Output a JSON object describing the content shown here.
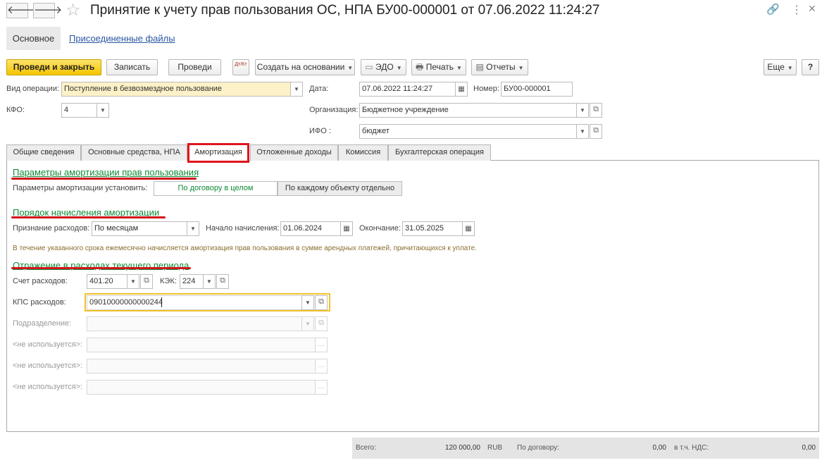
{
  "window": {
    "title": "Принятие к учету прав пользования ОС, НПА БУ00-000001 от 07.06.2022 11:24:27",
    "back_glyph": "🡐",
    "forward_glyph": "🡒",
    "star_glyph": "☆",
    "link_glyph": "🔗",
    "more_glyph": "⋮",
    "close_glyph": "✕"
  },
  "top_nav": {
    "main": "Основное",
    "files": "Присоединенные файлы"
  },
  "toolbar": {
    "post_close": "Проведи и закрыть",
    "save": "Записать",
    "post": "Проведи",
    "dtkt": "Дт/Кт",
    "create_based": "Создать на основании",
    "edo": "ЭДО",
    "print": "Печать",
    "reports": "Отчеты",
    "more": "Еще",
    "help": "?"
  },
  "header": {
    "operation_label": "Вид операции:",
    "operation_value": "Поступление в безвозмездное пользование",
    "date_label": "Дата:",
    "date_value": "07.06.2022 11:24:27",
    "number_label": "Номер:",
    "number_value": "БУ00-000001",
    "kfo_label": "КФО:",
    "kfo_value": "4",
    "org_label": "Организация:",
    "org_value": "Бюджетное учреждение",
    "ifo_label": "ИФО :",
    "ifo_value": "бюджет"
  },
  "tabs": [
    {
      "label": "Общие сведения"
    },
    {
      "label": "Основные средства, НПА"
    },
    {
      "label": "Амортизация"
    },
    {
      "label": "Отложенные доходы"
    },
    {
      "label": "Комиссия"
    },
    {
      "label": "Бухгалтерская операция"
    }
  ],
  "amort": {
    "params_title": "Параметры амортизации прав пользования",
    "params_label": "Параметры амортизации установить:",
    "option_contract": "По договору в целом",
    "option_each": "По каждому объекту отдельно",
    "order_title": "Порядок начисления амортизации",
    "recognition_label": "Признание расходов:",
    "recognition_value": "По месяцам",
    "start_label": "Начало начисления:",
    "start_value": "01.06.2024",
    "end_label": "Окончание:",
    "end_value": "31.05.2025",
    "hint": "В течение указанного срока ежемесячно начисляется амортизация прав пользования в сумме арендных платежей, причитающихся к уплате.",
    "expense_title": "Отражение в расходах текущего периода",
    "account_label": "Счет расходов:",
    "account_value": "401.20",
    "kek_label": "КЭК:",
    "kek_value": "224",
    "kps_label": "КПС расходов:",
    "kps_value": "09010000000000244",
    "division_label": "Подразделение:",
    "unused_label": "<не используется>:"
  },
  "footer": {
    "total_label": "Всего:",
    "total_value": "120 000,00",
    "currency": "RUB",
    "contract_label": "По договору:",
    "contract_value": "0,00",
    "vat_label": "в т.ч. НДС:",
    "vat_value": "0,00"
  }
}
